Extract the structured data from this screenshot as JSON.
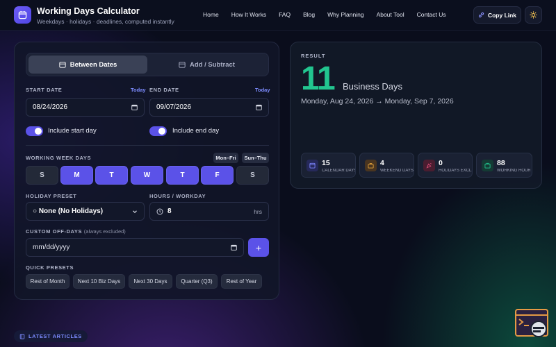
{
  "header": {
    "title": "Working Days Calculator",
    "subtitle": "Weekdays · holidays · deadlines, computed instantly",
    "nav": [
      "Home",
      "How It Works",
      "FAQ",
      "Blog",
      "Why Planning",
      "About Tool",
      "Contact Us"
    ],
    "copy_link": "Copy Link",
    "icons": {
      "logo": "calendar-icon",
      "copy": "link-icon",
      "theme": "sun-icon"
    }
  },
  "tabs": [
    {
      "label": "Between Dates",
      "active": true,
      "icon": "calendar-icon"
    },
    {
      "label": "Add / Subtract",
      "active": false,
      "icon": "calendar-icon"
    }
  ],
  "start": {
    "label": "START DATE",
    "today": "Today",
    "value": "08/24/2026",
    "toggle_label": "Include start day",
    "toggle_on": true
  },
  "end": {
    "label": "END DATE",
    "today": "Today",
    "value": "09/07/2026",
    "toggle_label": "Include end day",
    "toggle_on": true
  },
  "working_week": {
    "label": "WORKING WEEK DAYS",
    "shortcuts": [
      "Mon–Fri",
      "Sun–Thu"
    ],
    "days": [
      {
        "label": "S",
        "on": false
      },
      {
        "label": "M",
        "on": true
      },
      {
        "label": "T",
        "on": true
      },
      {
        "label": "W",
        "on": true
      },
      {
        "label": "T",
        "on": true
      },
      {
        "label": "F",
        "on": true
      },
      {
        "label": "S",
        "on": false
      }
    ]
  },
  "holiday_preset": {
    "label": "HOLIDAY PRESET",
    "value": "○ None (No Holidays)"
  },
  "hours": {
    "label": "HOURS / WORKDAY",
    "value": "8",
    "unit": "hrs"
  },
  "custom_off": {
    "label": "CUSTOM OFF-DAYS",
    "note": "(always excluded)",
    "placeholder": "mm/dd/yyyy",
    "add": "+"
  },
  "quick_presets": {
    "label": "QUICK PRESETS",
    "items": [
      "Rest of Month",
      "Next 10 Biz Days",
      "Next 30 Days",
      "Quarter (Q3)",
      "Rest of Year"
    ]
  },
  "result": {
    "label": "RESULT",
    "value": "11",
    "unit": "Business Days",
    "range": "Monday, Aug 24, 2026 → Monday, Sep 7, 2026",
    "stats": [
      {
        "value": "15",
        "caption": "CALENDAR DAYS",
        "icon": "calendar-icon",
        "color": "#5b64e8"
      },
      {
        "value": "4",
        "caption": "WEEKEND DAYS",
        "icon": "briefcase-icon",
        "color": "#e3a23a"
      },
      {
        "value": "0",
        "caption": "HOLIDAYS EXCL.",
        "icon": "party-icon",
        "color": "#e04e7a"
      },
      {
        "value": "88",
        "caption": "WORKING HOURS",
        "icon": "clock-icon",
        "color": "#22c58f"
      }
    ]
  },
  "articles": {
    "label": "LATEST ARTICLES"
  },
  "colors": {
    "accent": "#5b52e8",
    "result": "#22c58f",
    "link": "#7d8cff"
  }
}
